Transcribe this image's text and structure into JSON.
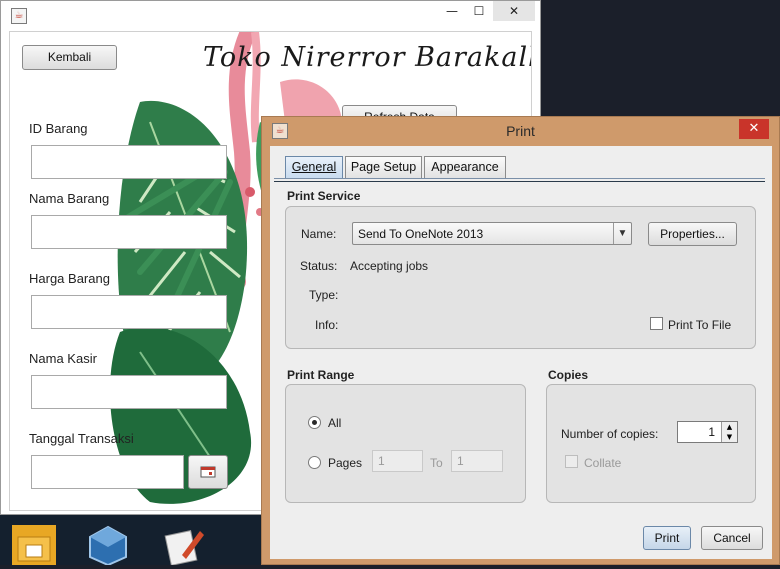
{
  "main_window": {
    "back_button": "Kembali",
    "shop_title": "Toko Nirerror Barakallah",
    "refresh_button": "Refresh Data",
    "fields": [
      {
        "label": "ID Barang"
      },
      {
        "label": "Nama Barang"
      },
      {
        "label": "Harga Barang"
      },
      {
        "label": "Nama Kasir"
      },
      {
        "label": "Tanggal Transaksi"
      }
    ],
    "minimize_glyph": "—",
    "maximize_glyph": "☐",
    "close_glyph": "✕"
  },
  "print_dialog": {
    "title": "Print",
    "close_glyph": "✕",
    "tabs": [
      {
        "label": "General",
        "selected": true
      },
      {
        "label": "Page Setup",
        "selected": false
      },
      {
        "label": "Appearance",
        "selected": false
      }
    ],
    "print_service": {
      "title": "Print Service",
      "name_label": "Name:",
      "name_value": "Send To OneNote 2013",
      "properties_button": "Properties...",
      "status_label": "Status:",
      "status_value": "Accepting jobs",
      "type_label": "Type:",
      "info_label": "Info:",
      "print_to_file_label": "Print To File",
      "print_to_file_checked": false
    },
    "print_range": {
      "title": "Print Range",
      "all_label": "All",
      "all_selected": true,
      "pages_label": "Pages",
      "from_value": "1",
      "to_label": "To",
      "to_value": "1"
    },
    "copies": {
      "title": "Copies",
      "number_label": "Number of copies:",
      "number_value": "1",
      "collate_label": "Collate",
      "collate_checked": false
    },
    "print_button": "Print",
    "cancel_button": "Cancel"
  },
  "colors": {
    "dialog_frame": "#cf9a6b",
    "close_red": "#c9342a",
    "tab_selected": "#c9dcef"
  }
}
